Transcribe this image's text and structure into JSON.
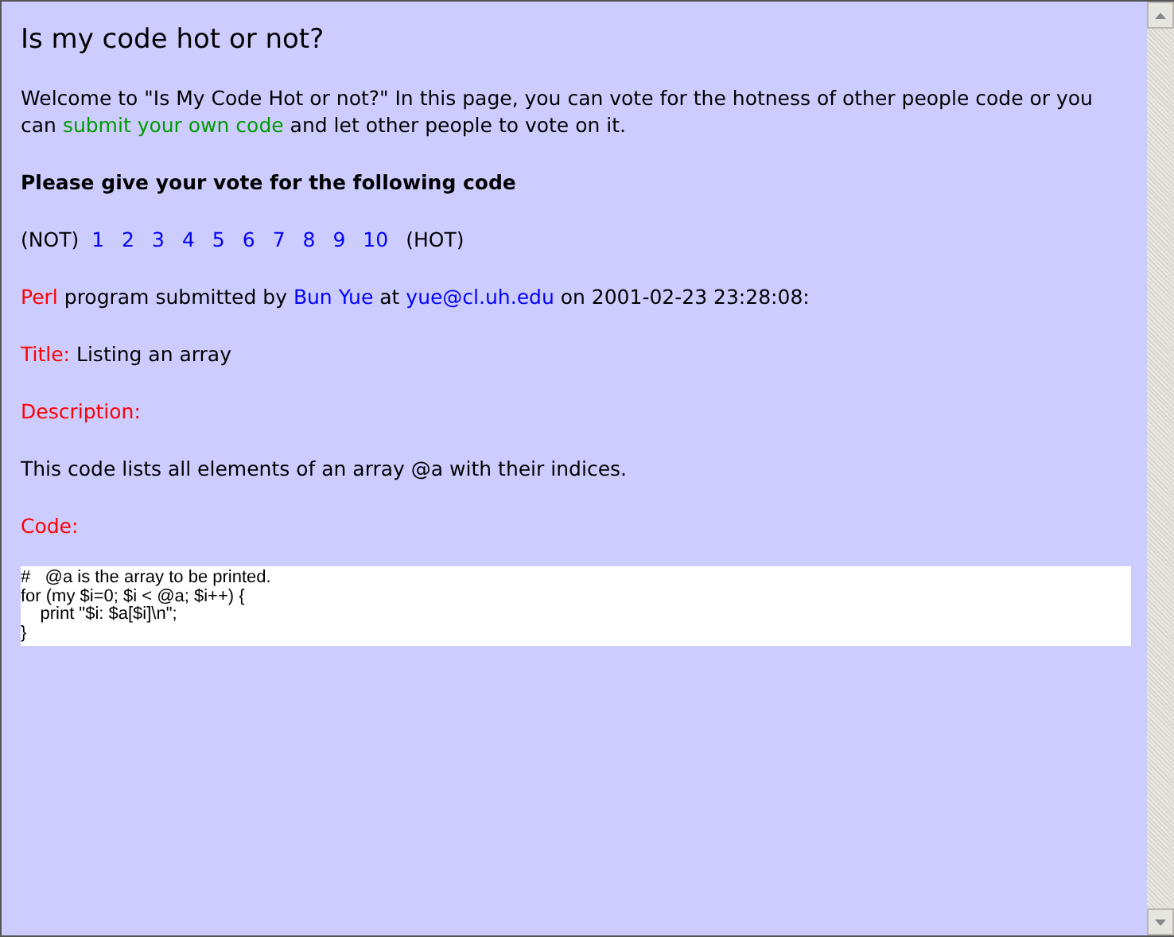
{
  "heading": "Is my code hot or not?",
  "intro": {
    "before": "Welcome to \"Is My Code Hot or not?\" In this page, you can vote for the hotness of other people code or you can ",
    "link": "submit your own code",
    "after": " and let other people to vote on it."
  },
  "vote_prompt": "Please give your vote for the following code",
  "vote": {
    "low_label": "(NOT)",
    "options": [
      "1",
      "2",
      "3",
      "4",
      "5",
      "6",
      "7",
      "8",
      "9",
      "10"
    ],
    "high_label": "(HOT)"
  },
  "submission": {
    "language": "Perl",
    "text1": " program submitted by ",
    "author": "Bun Yue",
    "text2": " at ",
    "email": "yue@cl.uh.edu",
    "text3": " on 2001-02-23 23:28:08:"
  },
  "title": {
    "label": "Title:",
    "value": "Listing an array"
  },
  "description": {
    "label": "Description:",
    "value": "This code lists all elements of an array @a with their indices."
  },
  "code": {
    "label": "Code:",
    "lines": [
      "#   @a is the array to be printed.",
      "for (my $i=0; $i < @a; $i++) {",
      "    print \"$i: $a[$i]\\n\";",
      "}"
    ]
  }
}
